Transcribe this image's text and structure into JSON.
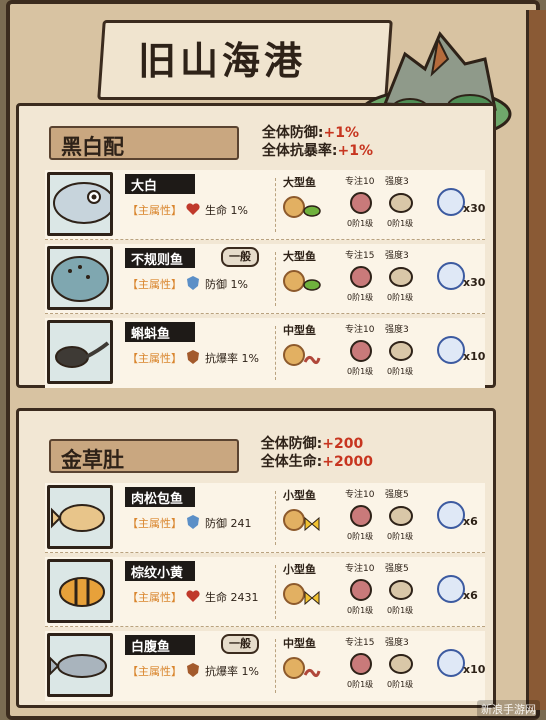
{
  "page_title": "旧山海港",
  "sections": [
    {
      "title": "黑白配",
      "bonus": [
        {
          "label": "全体防御:",
          "value": "+1%"
        },
        {
          "label": "全体抗暴率:",
          "value": "+1%"
        }
      ],
      "fish": [
        {
          "name": "大白",
          "rarity": "",
          "attr_tag": "【主属性】",
          "stat_icon": "heart-icon",
          "stat": "生命 1%",
          "size": "大型鱼",
          "rod": "专注10",
          "line": "强度3",
          "rod_sub": "0阶1级",
          "line_sub": "0阶1级",
          "coin_count": "x30"
        },
        {
          "name": "不规则鱼",
          "rarity": "一般",
          "attr_tag": "【主属性】",
          "stat_icon": "shield-blue-icon",
          "stat": "防御 1%",
          "size": "大型鱼",
          "rod": "专注15",
          "line": "强度3",
          "rod_sub": "0阶1级",
          "line_sub": "0阶1级",
          "coin_count": "x30"
        },
        {
          "name": "蝌蚪鱼",
          "rarity": "",
          "attr_tag": "【主属性】",
          "stat_icon": "shield-brown-icon",
          "stat": "抗爆率 1%",
          "size": "中型鱼",
          "rod": "专注10",
          "line": "强度3",
          "rod_sub": "0阶1级",
          "line_sub": "0阶1级",
          "coin_count": "x10"
        }
      ]
    },
    {
      "title": "金草肚",
      "bonus": [
        {
          "label": "全体防御:",
          "value": "+200"
        },
        {
          "label": "全体生命:",
          "value": "+2000"
        }
      ],
      "fish": [
        {
          "name": "肉松包鱼",
          "rarity": "",
          "attr_tag": "【主属性】",
          "stat_icon": "shield-blue-icon",
          "stat": "防御 241",
          "size": "小型鱼",
          "rod": "专注10",
          "line": "强度5",
          "rod_sub": "0阶1级",
          "line_sub": "0阶1级",
          "coin_count": "x6"
        },
        {
          "name": "棕纹小黄",
          "rarity": "",
          "attr_tag": "【主属性】",
          "stat_icon": "heart-icon",
          "stat": "生命 2431",
          "size": "小型鱼",
          "rod": "专注10",
          "line": "强度5",
          "rod_sub": "0阶1级",
          "line_sub": "0阶1级",
          "coin_count": "x6"
        },
        {
          "name": "白腹鱼",
          "rarity": "一般",
          "attr_tag": "【主属性】",
          "stat_icon": "shield-brown-icon",
          "stat": "抗爆率 1%",
          "size": "中型鱼",
          "rod": "专注15",
          "line": "强度3",
          "rod_sub": "0阶1级",
          "line_sub": "0阶1级",
          "coin_count": "x10"
        }
      ]
    }
  ],
  "watermark": "新浪手游网",
  "colors": {
    "bonus_value": "#c7351f",
    "attr_tag": "#d9852d",
    "name_bg": "#1e1a17"
  }
}
